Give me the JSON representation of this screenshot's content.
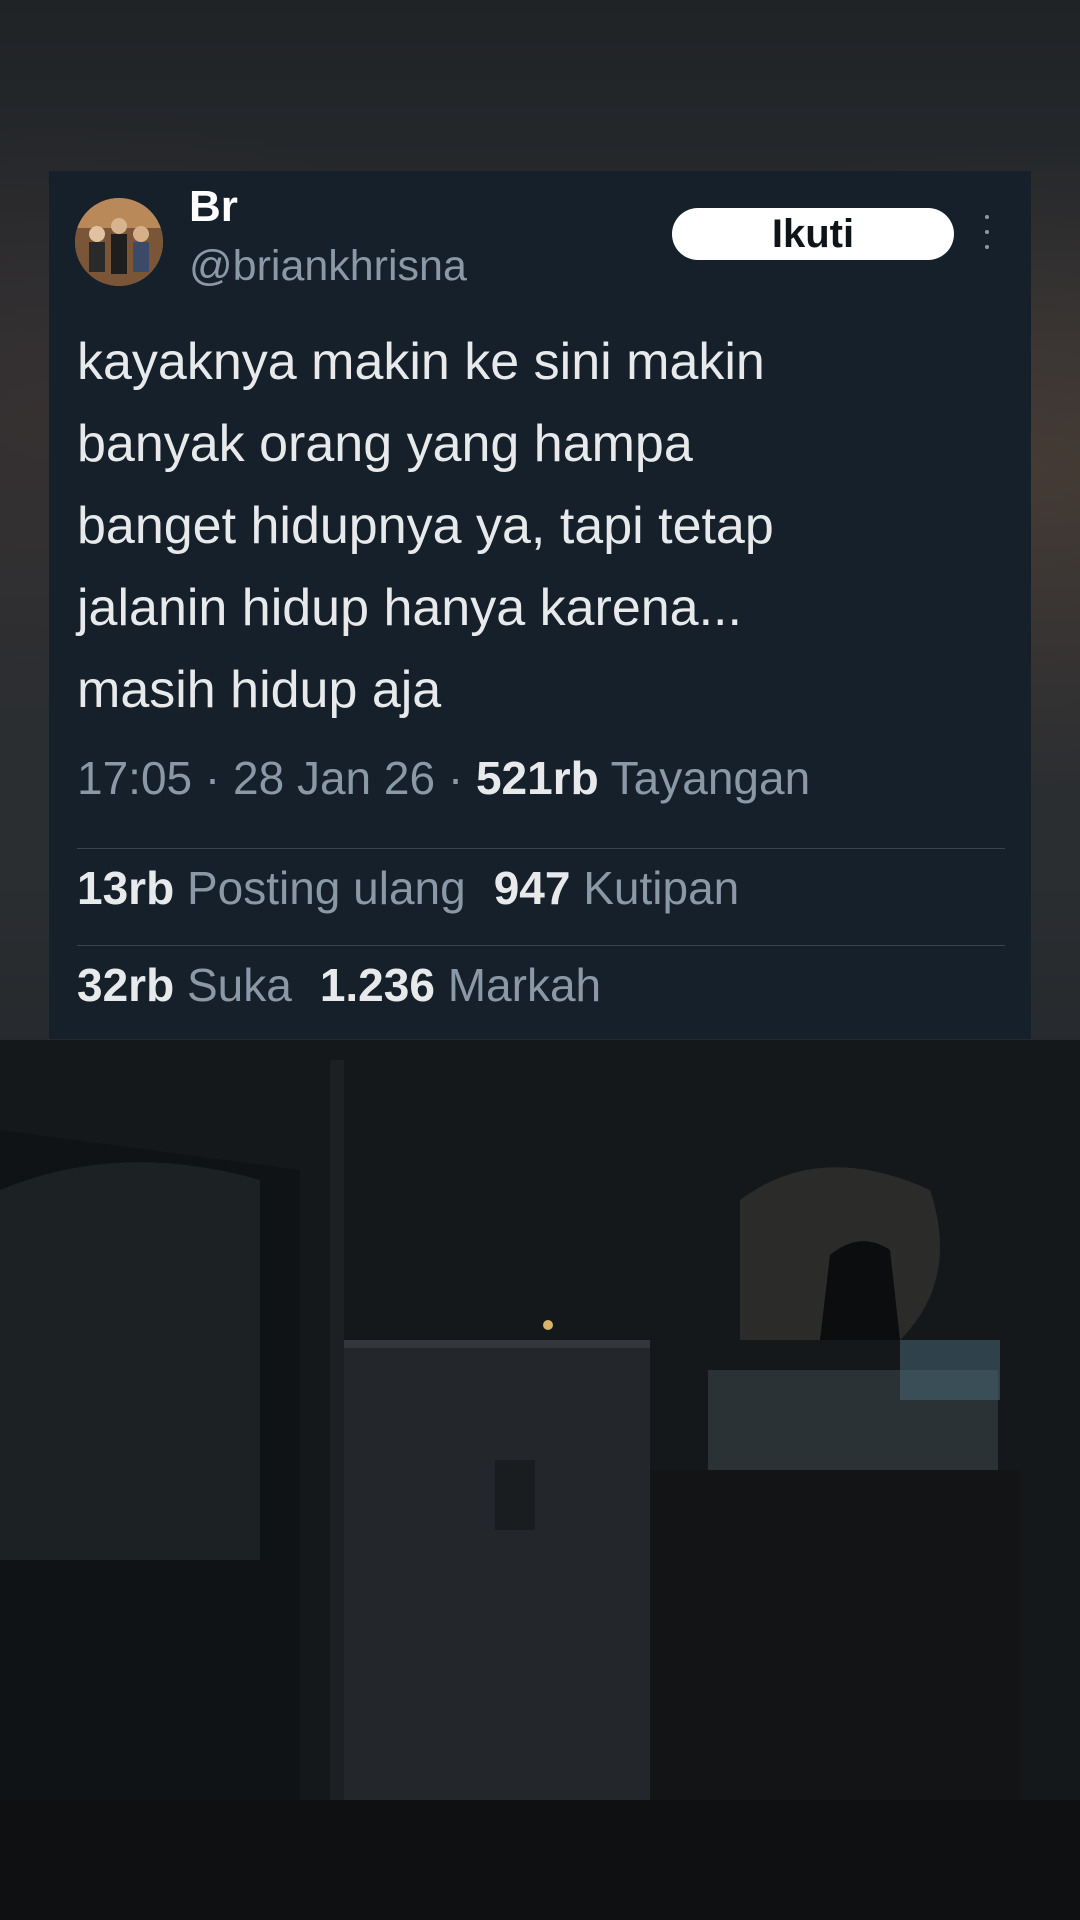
{
  "tweet": {
    "display_name": "Br",
    "handle": "@briankhrisna",
    "follow_label": "Ikuti",
    "text": "kayaknya makin ke sini makin\nbanyak orang yang hampa\nbanget hidupnya ya, tapi tetap\njalanin hidup hanya karena...\nmasih hidup aja",
    "time": "17:05",
    "date": "28 Jan 26",
    "separator": " · ",
    "views_count": "521rb",
    "views_label": "Tayangan",
    "reposts_count": "13rb",
    "reposts_label": "Posting ulang",
    "quotes_count": "947",
    "quotes_label": "Kutipan",
    "likes_count": "32rb",
    "likes_label": "Suka",
    "bookmarks_count": "1.236",
    "bookmarks_label": "Markah"
  },
  "colors": {
    "card_bg": "#15202b",
    "primary_text": "#e7e9ea",
    "secondary_text": "#8b98a5",
    "divider": "#38444d",
    "button_bg": "#ffffff"
  },
  "icons": {
    "more": "more-vertical-icon"
  }
}
